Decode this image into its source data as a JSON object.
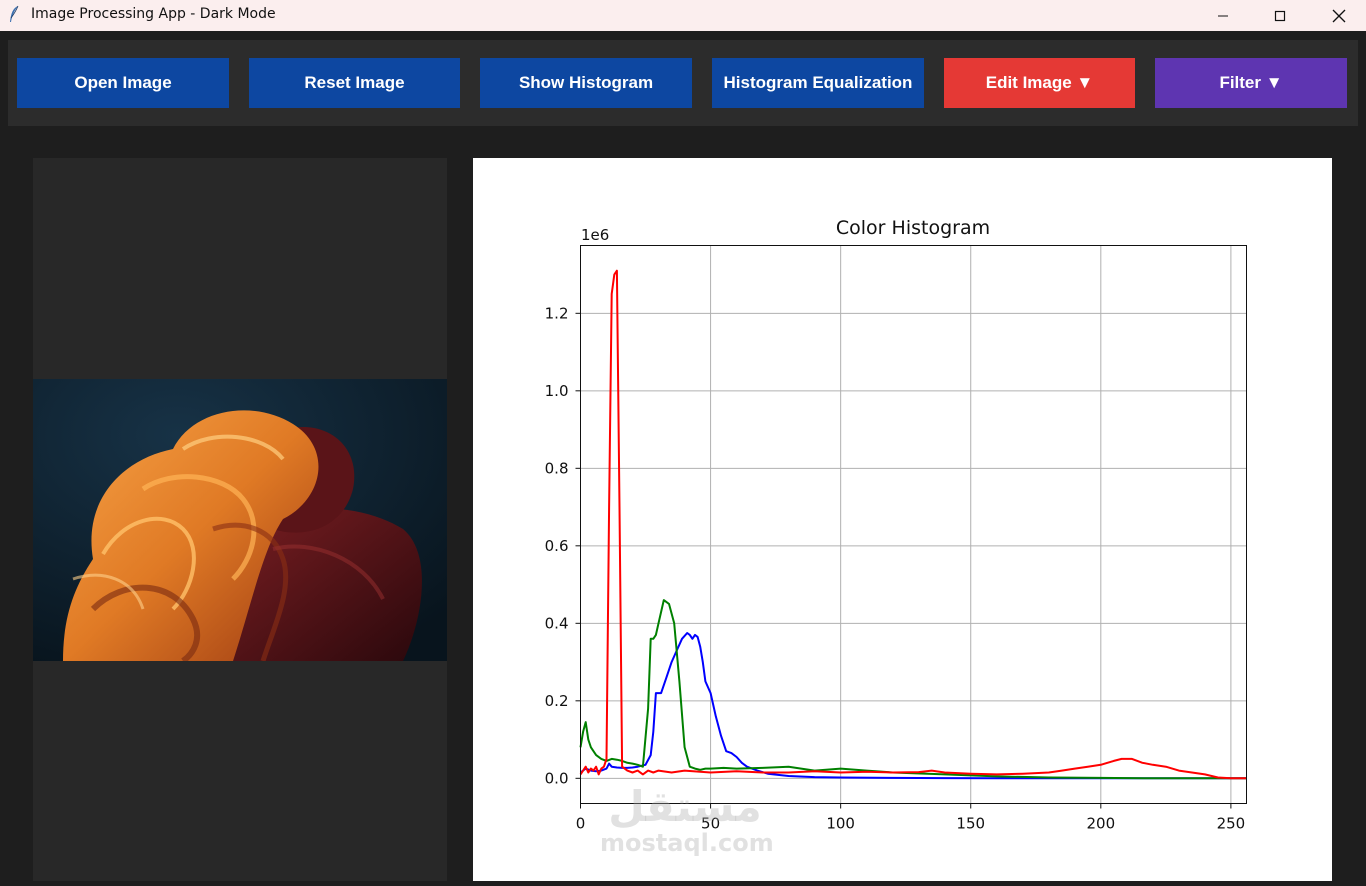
{
  "window": {
    "title": "Image Processing App - Dark Mode"
  },
  "toolbar": {
    "buttons": [
      {
        "label": "Open Image"
      },
      {
        "label": "Reset Image"
      },
      {
        "label": "Show Histogram"
      },
      {
        "label": "Histogram Equalization"
      },
      {
        "label": "Edit Image ▼"
      },
      {
        "label": "Filter ▼"
      }
    ]
  },
  "colors": {
    "primary": "#0d47a1",
    "edit": "#e53935",
    "filter": "#5e35b1",
    "background": "#1e1e1e"
  },
  "watermark": {
    "arabic": "مستقل",
    "latin": "mostaql.com"
  },
  "chart_data": {
    "type": "line",
    "title": "Color Histogram",
    "offset_label": "1e6",
    "xlim": [
      0,
      256
    ],
    "ylim": [
      -0.065,
      1.375
    ],
    "xticks": [
      0,
      50,
      100,
      150,
      200,
      250
    ],
    "yticks": [
      0.0,
      0.2,
      0.4,
      0.6,
      0.8,
      1.0,
      1.2
    ],
    "grid": true,
    "series": [
      {
        "color": "#0000ff",
        "x": [
          0,
          2,
          4,
          6,
          8,
          10,
          11,
          12,
          14,
          16,
          18,
          20,
          22,
          25,
          27,
          28,
          29,
          30,
          31,
          33,
          35,
          37,
          39,
          41,
          42,
          43,
          44,
          45,
          46,
          47,
          48,
          50,
          52,
          54,
          56,
          58,
          60,
          62,
          64,
          68,
          72,
          80,
          90,
          100,
          120,
          140,
          160,
          180,
          200,
          220,
          240,
          256
        ],
        "y": [
          0.015,
          0.025,
          0.02,
          0.018,
          0.02,
          0.025,
          0.038,
          0.03,
          0.028,
          0.027,
          0.027,
          0.028,
          0.03,
          0.035,
          0.06,
          0.12,
          0.22,
          0.22,
          0.22,
          0.26,
          0.3,
          0.33,
          0.36,
          0.375,
          0.37,
          0.36,
          0.37,
          0.365,
          0.34,
          0.3,
          0.25,
          0.22,
          0.16,
          0.11,
          0.07,
          0.065,
          0.055,
          0.04,
          0.03,
          0.02,
          0.012,
          0.006,
          0.003,
          0.002,
          0.001,
          0.0005,
          0.0003,
          0.0002,
          0.0001,
          0.0,
          0.0,
          0.0
        ]
      },
      {
        "color": "#008000",
        "x": [
          0,
          1,
          2,
          3,
          4,
          6,
          8,
          10,
          12,
          14,
          16,
          18,
          20,
          22,
          24,
          26,
          27,
          28,
          29,
          30,
          32,
          34,
          36,
          38,
          40,
          42,
          44,
          46,
          48,
          50,
          55,
          60,
          70,
          80,
          90,
          100,
          110,
          120,
          140,
          160,
          180,
          200,
          220,
          256
        ],
        "y": [
          0.08,
          0.12,
          0.145,
          0.1,
          0.08,
          0.06,
          0.05,
          0.045,
          0.05,
          0.048,
          0.045,
          0.04,
          0.038,
          0.035,
          0.03,
          0.18,
          0.36,
          0.36,
          0.37,
          0.4,
          0.46,
          0.45,
          0.4,
          0.25,
          0.08,
          0.03,
          0.025,
          0.022,
          0.025,
          0.025,
          0.027,
          0.025,
          0.027,
          0.03,
          0.02,
          0.025,
          0.02,
          0.015,
          0.01,
          0.005,
          0.002,
          0.001,
          0.0,
          0.0
        ]
      },
      {
        "color": "#ff0000",
        "x": [
          0,
          1,
          2,
          3,
          4,
          5,
          6,
          7,
          8,
          9,
          10,
          11,
          12,
          13,
          14,
          15,
          16,
          18,
          20,
          22,
          24,
          26,
          28,
          30,
          35,
          40,
          50,
          60,
          70,
          80,
          90,
          100,
          110,
          120,
          130,
          135,
          140,
          150,
          160,
          170,
          180,
          185,
          190,
          195,
          200,
          205,
          208,
          212,
          216,
          220,
          225,
          230,
          235,
          240,
          245,
          250,
          256
        ],
        "y": [
          0.01,
          0.02,
          0.03,
          0.015,
          0.025,
          0.02,
          0.03,
          0.01,
          0.025,
          0.03,
          0.05,
          0.7,
          1.25,
          1.3,
          1.31,
          0.7,
          0.03,
          0.02,
          0.015,
          0.02,
          0.01,
          0.02,
          0.015,
          0.02,
          0.015,
          0.02,
          0.015,
          0.018,
          0.015,
          0.015,
          0.018,
          0.015,
          0.017,
          0.015,
          0.016,
          0.02,
          0.015,
          0.012,
          0.01,
          0.012,
          0.015,
          0.02,
          0.025,
          0.03,
          0.035,
          0.045,
          0.05,
          0.05,
          0.04,
          0.035,
          0.03,
          0.02,
          0.015,
          0.01,
          0.002,
          0.0,
          0.0
        ]
      }
    ]
  }
}
